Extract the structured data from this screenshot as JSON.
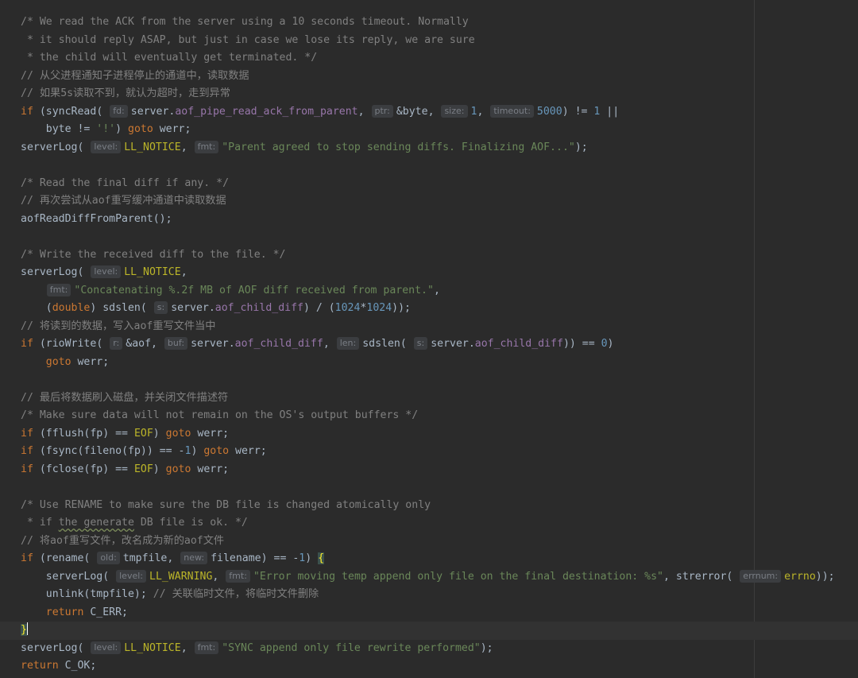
{
  "colors": {
    "background": "#2b2b2b",
    "comment": "#808080",
    "keyword": "#cc7832",
    "field": "#9876aa",
    "number": "#6897bb",
    "string": "#6a8759",
    "macro": "#bbb529",
    "default": "#a9b7c6",
    "hint_bg": "#3b3d40"
  },
  "lines": [
    [
      [
        "c",
        "/* We read the ACK from the server using a 10 seconds timeout. Normally"
      ]
    ],
    [
      [
        "c",
        " * it should reply ASAP, but just in case we lose its reply, we are sure"
      ]
    ],
    [
      [
        "c",
        " * the child will eventually get terminated. */"
      ]
    ],
    [
      [
        "c",
        "// 从父进程通知子进程停止的通道中，读取数据"
      ]
    ],
    [
      [
        "c",
        "// 如果5s读取不到，就认为超时，走到异常"
      ]
    ],
    [
      [
        "k",
        "if "
      ],
      [
        "p",
        "("
      ],
      [
        "f",
        "syncRead"
      ],
      [
        "p",
        "( "
      ],
      [
        "h",
        "fd:"
      ],
      [
        "v",
        "server"
      ],
      [
        "p",
        "."
      ],
      [
        "fld",
        "aof_pipe_read_ack_from_parent"
      ],
      [
        "p",
        ", "
      ],
      [
        "h",
        "ptr:"
      ],
      [
        "p",
        "&"
      ],
      [
        "v",
        "byte"
      ],
      [
        "p",
        ", "
      ],
      [
        "h",
        "size:"
      ],
      [
        "n",
        "1"
      ],
      [
        "p",
        ", "
      ],
      [
        "h",
        "timeout:"
      ],
      [
        "n",
        "5000"
      ],
      [
        "p",
        ") != "
      ],
      [
        "n",
        "1"
      ],
      [
        "p",
        " ||"
      ]
    ],
    [
      [
        "p",
        "    "
      ],
      [
        "v",
        "byte"
      ],
      [
        "p",
        " != "
      ],
      [
        "s",
        "'!'"
      ],
      [
        "p",
        ") "
      ],
      [
        "k",
        "goto"
      ],
      [
        "p",
        " werr;"
      ]
    ],
    [
      [
        "f",
        "serverLog"
      ],
      [
        "p",
        "( "
      ],
      [
        "h",
        "level:"
      ],
      [
        "m",
        "LL_NOTICE"
      ],
      [
        "p",
        ", "
      ],
      [
        "h",
        "fmt:"
      ],
      [
        "s",
        "\"Parent agreed to stop sending diffs. Finalizing AOF...\""
      ],
      [
        "p",
        ");"
      ]
    ],
    [],
    [
      [
        "c",
        "/* Read the final diff if any. */"
      ]
    ],
    [
      [
        "c",
        "// 再次尝试从aof重写缓冲通道中读取数据"
      ]
    ],
    [
      [
        "f",
        "aofReadDiffFromParent"
      ],
      [
        "p",
        "();"
      ]
    ],
    [],
    [
      [
        "c",
        "/* Write the received diff to the file. */"
      ]
    ],
    [
      [
        "f",
        "serverLog"
      ],
      [
        "p",
        "( "
      ],
      [
        "h",
        "level:"
      ],
      [
        "m",
        "LL_NOTICE"
      ],
      [
        "p",
        ","
      ]
    ],
    [
      [
        "p",
        "    "
      ],
      [
        "h",
        "fmt:"
      ],
      [
        "s",
        "\"Concatenating %.2f MB of AOF diff received from parent.\""
      ],
      [
        "p",
        ","
      ]
    ],
    [
      [
        "p",
        "    ("
      ],
      [
        "k",
        "double"
      ],
      [
        "p",
        ") "
      ],
      [
        "f",
        "sdslen"
      ],
      [
        "p",
        "( "
      ],
      [
        "h",
        "s:"
      ],
      [
        "v",
        "server"
      ],
      [
        "p",
        "."
      ],
      [
        "fld",
        "aof_child_diff"
      ],
      [
        "p",
        ") / ("
      ],
      [
        "n",
        "1024"
      ],
      [
        "p",
        "*"
      ],
      [
        "n",
        "1024"
      ],
      [
        "p",
        "));"
      ]
    ],
    [
      [
        "c",
        "// 将读到的数据，写入aof重写文件当中"
      ]
    ],
    [
      [
        "k",
        "if "
      ],
      [
        "p",
        "("
      ],
      [
        "f",
        "rioWrite"
      ],
      [
        "p",
        "( "
      ],
      [
        "h",
        "r:"
      ],
      [
        "p",
        "&"
      ],
      [
        "v",
        "aof"
      ],
      [
        "p",
        ", "
      ],
      [
        "h",
        "buf:"
      ],
      [
        "v",
        "server"
      ],
      [
        "p",
        "."
      ],
      [
        "fld",
        "aof_child_diff"
      ],
      [
        "p",
        ", "
      ],
      [
        "h",
        "len:"
      ],
      [
        "f",
        "sdslen"
      ],
      [
        "p",
        "( "
      ],
      [
        "h",
        "s:"
      ],
      [
        "v",
        "server"
      ],
      [
        "p",
        "."
      ],
      [
        "fld",
        "aof_child_diff"
      ],
      [
        "p",
        ")) == "
      ],
      [
        "n",
        "0"
      ],
      [
        "p",
        ")"
      ]
    ],
    [
      [
        "p",
        "    "
      ],
      [
        "k",
        "goto"
      ],
      [
        "p",
        " werr;"
      ]
    ],
    [],
    [
      [
        "c",
        "// 最后将数据刷入磁盘，并关闭文件描述符"
      ]
    ],
    [
      [
        "c",
        "/* Make sure data will not remain on the OS's output buffers */"
      ]
    ],
    [
      [
        "k",
        "if "
      ],
      [
        "p",
        "("
      ],
      [
        "f",
        "fflush"
      ],
      [
        "p",
        "(fp) == "
      ],
      [
        "m",
        "EOF"
      ],
      [
        "p",
        ") "
      ],
      [
        "k",
        "goto"
      ],
      [
        "p",
        " werr;"
      ]
    ],
    [
      [
        "k",
        "if "
      ],
      [
        "p",
        "("
      ],
      [
        "f",
        "fsync"
      ],
      [
        "p",
        "("
      ],
      [
        "f",
        "fileno"
      ],
      [
        "p",
        "(fp)) == -"
      ],
      [
        "n",
        "1"
      ],
      [
        "p",
        ") "
      ],
      [
        "k",
        "goto"
      ],
      [
        "p",
        " werr;"
      ]
    ],
    [
      [
        "k",
        "if "
      ],
      [
        "p",
        "("
      ],
      [
        "f",
        "fclose"
      ],
      [
        "p",
        "(fp) == "
      ],
      [
        "m",
        "EOF"
      ],
      [
        "p",
        ") "
      ],
      [
        "k",
        "goto"
      ],
      [
        "p",
        " werr;"
      ]
    ],
    [],
    [
      [
        "c",
        "/* Use RENAME to make sure the DB file is changed atomically only"
      ]
    ],
    [
      [
        "c",
        " * if "
      ],
      [
        "cw",
        "the generate"
      ],
      [
        "c",
        " DB file is ok. */"
      ]
    ],
    [
      [
        "c",
        "// 将aof重写文件，改名成为新的aof文件"
      ]
    ],
    [
      [
        "k",
        "if "
      ],
      [
        "p",
        "("
      ],
      [
        "f",
        "rename"
      ],
      [
        "p",
        "( "
      ],
      [
        "h",
        "old:"
      ],
      [
        "v",
        "tmpfile"
      ],
      [
        "p",
        ", "
      ],
      [
        "h",
        "new:"
      ],
      [
        "v",
        "filename"
      ],
      [
        "p",
        ") == -"
      ],
      [
        "n",
        "1"
      ],
      [
        "p",
        ") "
      ],
      [
        "bm",
        "{"
      ]
    ],
    [
      [
        "p",
        "    "
      ],
      [
        "f",
        "serverLog"
      ],
      [
        "p",
        "( "
      ],
      [
        "h",
        "level:"
      ],
      [
        "m",
        "LL_WARNING"
      ],
      [
        "p",
        ", "
      ],
      [
        "h",
        "fmt:"
      ],
      [
        "s",
        "\"Error moving temp append only file on the final destination: %s\""
      ],
      [
        "p",
        ", "
      ],
      [
        "f",
        "strerror"
      ],
      [
        "p",
        "( "
      ],
      [
        "h",
        "errnum:"
      ],
      [
        "m",
        "errno"
      ],
      [
        "p",
        "));"
      ]
    ],
    [
      [
        "p",
        "    "
      ],
      [
        "f",
        "unlink"
      ],
      [
        "p",
        "(tmpfile); "
      ],
      [
        "c",
        "// 关联临时文件，将临时文件删除"
      ]
    ],
    [
      [
        "p",
        "    "
      ],
      [
        "k",
        "return"
      ],
      [
        "p",
        " C_ERR;"
      ]
    ],
    [
      [
        "bm",
        "}"
      ],
      [
        "caret",
        ""
      ]
    ],
    [
      [
        "f",
        "serverLog"
      ],
      [
        "p",
        "( "
      ],
      [
        "h",
        "level:"
      ],
      [
        "m",
        "LL_NOTICE"
      ],
      [
        "p",
        ", "
      ],
      [
        "h",
        "fmt:"
      ],
      [
        "s",
        "\"SYNC append only file rewrite performed\""
      ],
      [
        "p",
        ");"
      ]
    ],
    [
      [
        "k",
        "return"
      ],
      [
        "p",
        " C_OK;"
      ]
    ]
  ],
  "current_line": 34
}
